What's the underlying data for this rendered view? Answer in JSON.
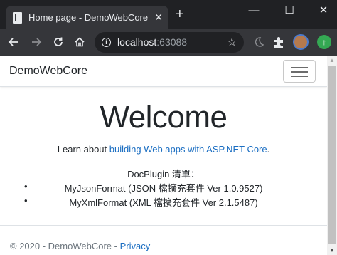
{
  "browser": {
    "tab_title": "Home page - DemoWebCore",
    "tab_close": "✕",
    "new_tab": "+",
    "window_controls": {
      "minimize": "—",
      "maximize": "☐",
      "close": "✕"
    },
    "url_host": "localhost",
    "url_port": ":63088",
    "icons": [
      "back-arrow-icon",
      "forward-arrow-icon",
      "reload-icon",
      "home-icon",
      "info-icon",
      "star-icon",
      "extension-moon-icon",
      "puzzle-icon",
      "profile-avatar",
      "update-icon"
    ]
  },
  "site": {
    "brand": "DemoWebCore",
    "heading": "Welcome",
    "learn_prefix": "Learn about ",
    "learn_link": "building Web apps with ASP.NET Core",
    "learn_suffix": ".",
    "plugin_title": "DocPlugin 清單：",
    "plugins": [
      "MyJsonFormat (JSON 檔擴充套件 Ver 1.0.9527)",
      "MyXmlFormat (XML 檔擴充套件 Ver 2.1.5487)"
    ],
    "bullet": "•",
    "footer_prefix": "© 2020 - DemoWebCore - ",
    "footer_link": "Privacy"
  },
  "colors": {
    "titlebar": "#202124",
    "toolbar": "#35363a",
    "link": "#1b6ec2",
    "text": "#212529",
    "muted": "#6c757d"
  }
}
